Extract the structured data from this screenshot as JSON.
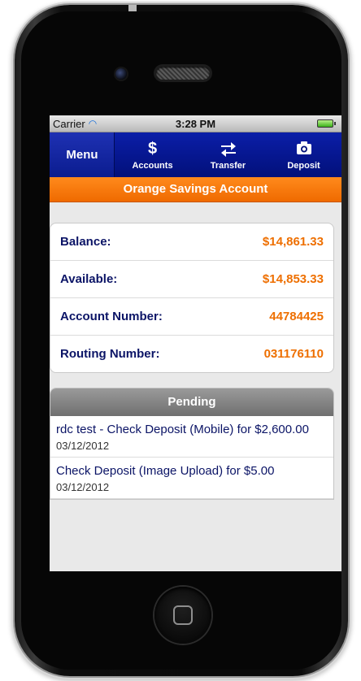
{
  "status_bar": {
    "carrier": "Carrier",
    "time": "3:28 PM",
    "wifi_icon": "wifi-icon",
    "battery_icon": "battery-icon"
  },
  "nav": {
    "menu_label": "Menu",
    "items": [
      {
        "label": "Accounts",
        "icon": "dollar-icon"
      },
      {
        "label": "Transfer",
        "icon": "transfer-icon"
      },
      {
        "label": "Deposit",
        "icon": "camera-icon"
      }
    ]
  },
  "account": {
    "title": "Orange Savings Account",
    "rows": [
      {
        "label": "Balance:",
        "value": "$14,861.33"
      },
      {
        "label": "Available:",
        "value": "$14,853.33"
      },
      {
        "label": "Account Number:",
        "value": "44784425"
      },
      {
        "label": "Routing Number:",
        "value": "031176110"
      }
    ]
  },
  "pending": {
    "title": "Pending",
    "items": [
      {
        "description": "rdc test - Check Deposit (Mobile) for $2,600.00",
        "date": "03/12/2012"
      },
      {
        "description": "Check Deposit (Image Upload) for $5.00",
        "date": "03/12/2012"
      }
    ]
  },
  "colors": {
    "nav_blue": "#0b1ea8",
    "accent_orange": "#ef6a00",
    "label_navy": "#0b1466"
  }
}
